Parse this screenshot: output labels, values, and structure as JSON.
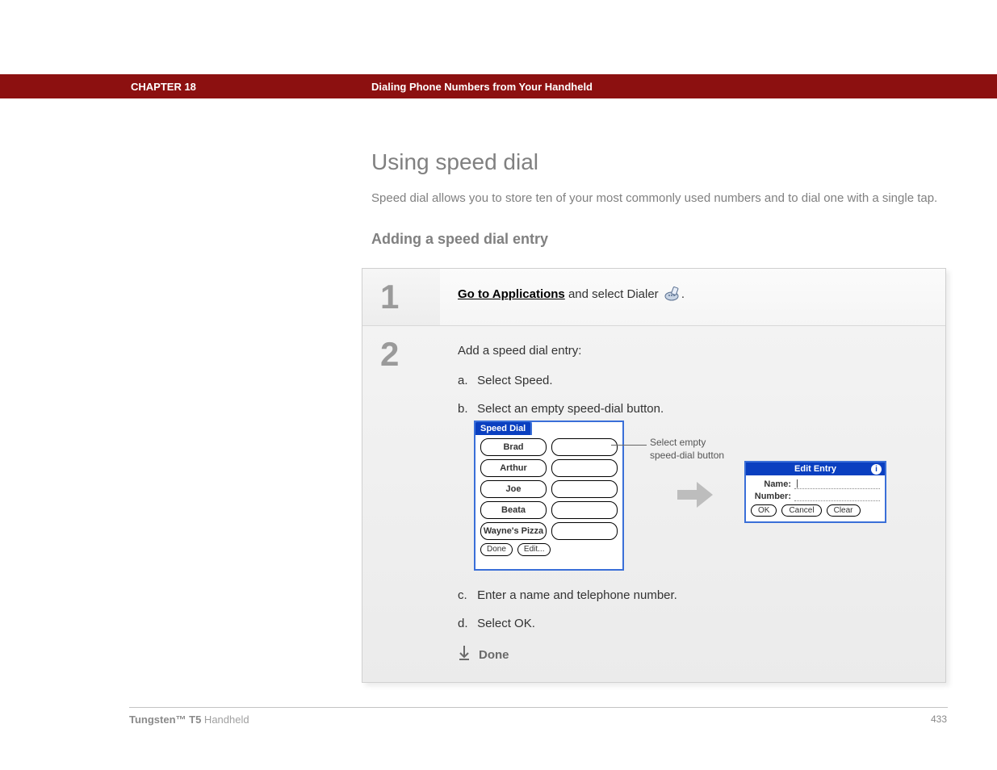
{
  "header": {
    "chapter": "CHAPTER 18",
    "title": "Dialing Phone Numbers from Your Handheld"
  },
  "main": {
    "h1": "Using speed dial",
    "intro": "Speed dial allows you to store ten of your most commonly used numbers and to dial one with a single tap.",
    "h2": "Adding a speed dial entry"
  },
  "steps": {
    "one": {
      "num": "1",
      "link_text": "Go to Applications",
      "rest_text": " and select Dialer ",
      "period": "."
    },
    "two": {
      "num": "2",
      "intro": "Add a speed dial entry:",
      "a_marker": "a.",
      "a_text": "Select Speed.",
      "b_marker": "b.",
      "b_text": "Select an empty speed-dial button.",
      "c_marker": "c.",
      "c_text": "Enter a name and telephone number.",
      "d_marker": "d.",
      "d_text": "Select OK.",
      "done": "Done"
    }
  },
  "speeddial": {
    "tab": "Speed Dial",
    "buttons": [
      "Brad",
      "Arthur",
      "Joe",
      "Beata",
      "Wayne's Pizza"
    ],
    "footer": {
      "done": "Done",
      "edit": "Edit..."
    },
    "callout_l1": "Select empty",
    "callout_l2": "speed-dial button"
  },
  "editentry": {
    "title": "Edit Entry",
    "name_label": "Name:",
    "number_label": "Number:",
    "ok": "OK",
    "cancel": "Cancel",
    "clear": "Clear"
  },
  "footer": {
    "product_bold": "Tungsten™ T5",
    "product_rest": " Handheld",
    "page": "433"
  }
}
